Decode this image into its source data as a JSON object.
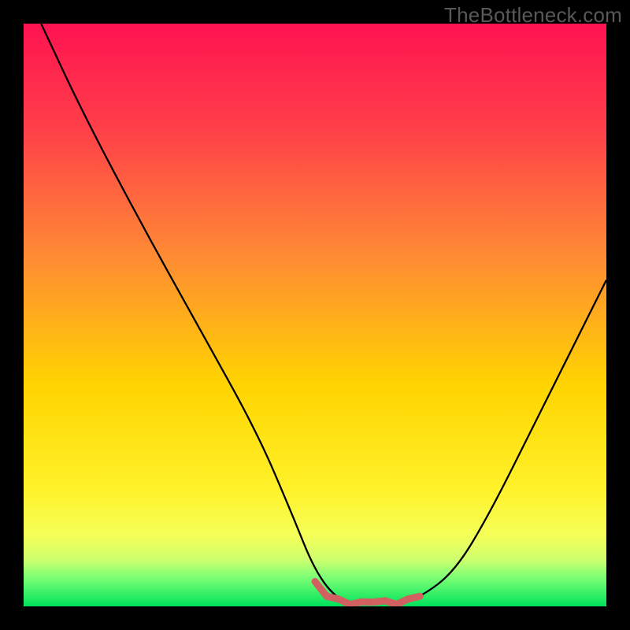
{
  "watermark": "TheBottleneck.com",
  "chart_data": {
    "type": "line",
    "title": "",
    "xlabel": "",
    "ylabel": "",
    "xlim": [
      0,
      100
    ],
    "ylim": [
      0,
      100
    ],
    "grid": false,
    "legend": false,
    "annotations": [],
    "series": [
      {
        "name": "bottleneck-curve",
        "x": [
          3,
          10,
          20,
          30,
          40,
          46,
          50,
          54,
          58,
          60,
          64,
          68,
          74,
          80,
          88,
          94,
          100
        ],
        "y": [
          100,
          85,
          66,
          48,
          30,
          16,
          6,
          1,
          0.5,
          1,
          0.5,
          1.5,
          6,
          16,
          32,
          44,
          56
        ]
      },
      {
        "name": "bottom-highlight",
        "x": [
          50,
          52,
          54,
          56,
          58,
          60,
          62,
          64,
          66,
          68
        ],
        "y": [
          4,
          2,
          1,
          0.6,
          0.5,
          1,
          0.7,
          0.6,
          1,
          2
        ]
      }
    ],
    "background": {
      "top_color": "#ff1351",
      "mid_color": "#ffd400",
      "low_green_start": "#e8ff52",
      "green": "#00e35b",
      "green_region_y": [
        0,
        7
      ]
    },
    "colors": {
      "curve": "#000000",
      "highlight": "#d16060"
    }
  }
}
